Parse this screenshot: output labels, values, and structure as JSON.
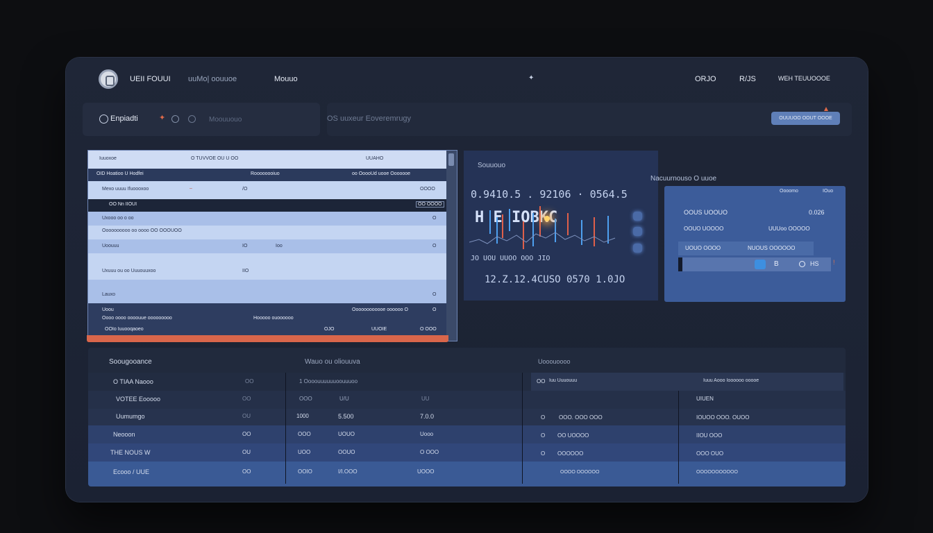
{
  "topbar": {
    "app_name": "UEII FOUUI",
    "nav1": "uuMo| oouuoe",
    "nav2": "Mouuo",
    "center_icon": "gear-icon",
    "right1": "ORJO",
    "right2": "R/JS",
    "right3": "WEH TEUUOOOE"
  },
  "toolbar": {
    "label": "Enpiadti",
    "placeholder": "Moouuouo",
    "status": "OS uuxeur Eoveremrugy",
    "action_button": "OUUUOO OOUT OOOE"
  },
  "left_table": {
    "header": {
      "c1": "Iuuoxoe",
      "c2": "O TUVVOE OU U OO",
      "c3": "UUAHO"
    },
    "rows": [
      {
        "c1": "OID  Hoatioo  U  Hodfei",
        "c2": "Roooooooiuo",
        "c3": "oo  OoooUd uooe Ooooooe"
      },
      {
        "c1": "Mexo uuuu Ifuoooxoo",
        "c2": "–",
        "c3": "/O",
        "c4": "OOOO"
      },
      {
        "c1": "OO  Nn IIOUI",
        "c2": "",
        "c3": "",
        "c4": "OO OOOO"
      },
      {
        "c1": "Uxooo oo o oo",
        "c2": "",
        "c3": "",
        "c4": "O"
      },
      {
        "c1": "Oooooooooo oo oooo OO OOOUOO",
        "c2": "",
        "c3": "",
        "c4": ""
      },
      {
        "c1": "Uoouuu",
        "c2": "IO",
        "c3": "Ioo",
        "c4": "O"
      },
      {
        "c1": "Uxuuu ou oo Uuuouuxoo",
        "c2": "IIO",
        "c3": "",
        "c4": ""
      },
      {
        "c1": "Lauxo",
        "c2": "",
        "c3": "",
        "c4": "O"
      },
      {
        "c1": "Uoou",
        "c2": "",
        "c3": "Oooooooooooe oooooo O",
        "c4": "O"
      },
      {
        "c1": "Oooo oooo oooouue ooooooooo",
        "c2": "Hooooo ouoooooo",
        "c3": "",
        "c4": ""
      },
      {
        "c1": "OOIo  Iuuooqaoeo",
        "c2": "OJO",
        "c3": "UUOIE",
        "c4": "O OOO"
      }
    ]
  },
  "chart": {
    "label": "Souuouo",
    "line1": "0.9410.5 . 92106 · 0564.5",
    "mark": "H  E  IOBKC",
    "line2": "JO  UOU  UUOO OOO  JIO",
    "line3": "12.Z.12.4CUSO  0570 1.0JO"
  },
  "right_panel": {
    "title": "Nacuurnouso O uuoe",
    "head_a": "Oooomo",
    "head_b": "IOuo",
    "row1_label": "OOUS UOOUO",
    "row1_value": "0.026",
    "row2_label": "OOUO UOOOO",
    "row2_value": "UUUoo OOOOO",
    "row3_label": "UOUO OOOO",
    "row3_value": "NUOUS OOOOOO",
    "ctrl_a": "B",
    "ctrl_b": "HS"
  },
  "bottom": {
    "section_title": "Soougooance",
    "col_title": "Wauo ou oliouuva",
    "right_title": "Uooouoooo",
    "left_rows": [
      {
        "name": "O TIAA Naooo",
        "v1": "OO",
        "v2": "1 Oooouuuuuuoouuuoo"
      },
      {
        "name": "VOTEE Eooooo",
        "v1": "OO",
        "v2": "OOO",
        "v3": "U/U",
        "v4": "UU"
      },
      {
        "name": "Uumumgo",
        "v1": "OU",
        "v2": "1000",
        "v3": "5.500",
        "v4": "7.0.0"
      },
      {
        "name": "Neooon",
        "v1": "OO",
        "v2": "OOO",
        "v3": "UOUO",
        "v4": "Uooo"
      },
      {
        "name": "THE NOUS W",
        "v1": "OU",
        "v2": "UOO",
        "v3": "OOUO",
        "v4": "O OOO"
      },
      {
        "name": "Ecooo / UUE",
        "v1": "OO",
        "v2": "OOIO",
        "v3": "I/I.OOO",
        "v4": "UOOO"
      }
    ],
    "right_rows": [
      {
        "a": "OO",
        "b": "Iuu Uuuouuu",
        "c": "Iuuu Aooo Ioooooo ooooe"
      },
      {
        "a": "",
        "b": "",
        "c": "UIUEN"
      },
      {
        "a": "O",
        "b": "OOO.  OOO OOO",
        "c": "IOUOO OOO. OUOO"
      },
      {
        "a": "O",
        "b": "OO  UOOOO",
        "c": "IIOU OOO"
      },
      {
        "a": "O",
        "b": "OOOOOO",
        "c": "OOO OUO"
      },
      {
        "a": "",
        "b": "OOOO OOOOOO",
        "c": "OOOOOOOOOOO"
      }
    ]
  },
  "colors": {
    "background": "#0d0e11",
    "frame": "#1f2637",
    "accent_blue": "#5f7fb8",
    "accent_orange": "#d9664b",
    "table_light": "#b7cbef"
  }
}
